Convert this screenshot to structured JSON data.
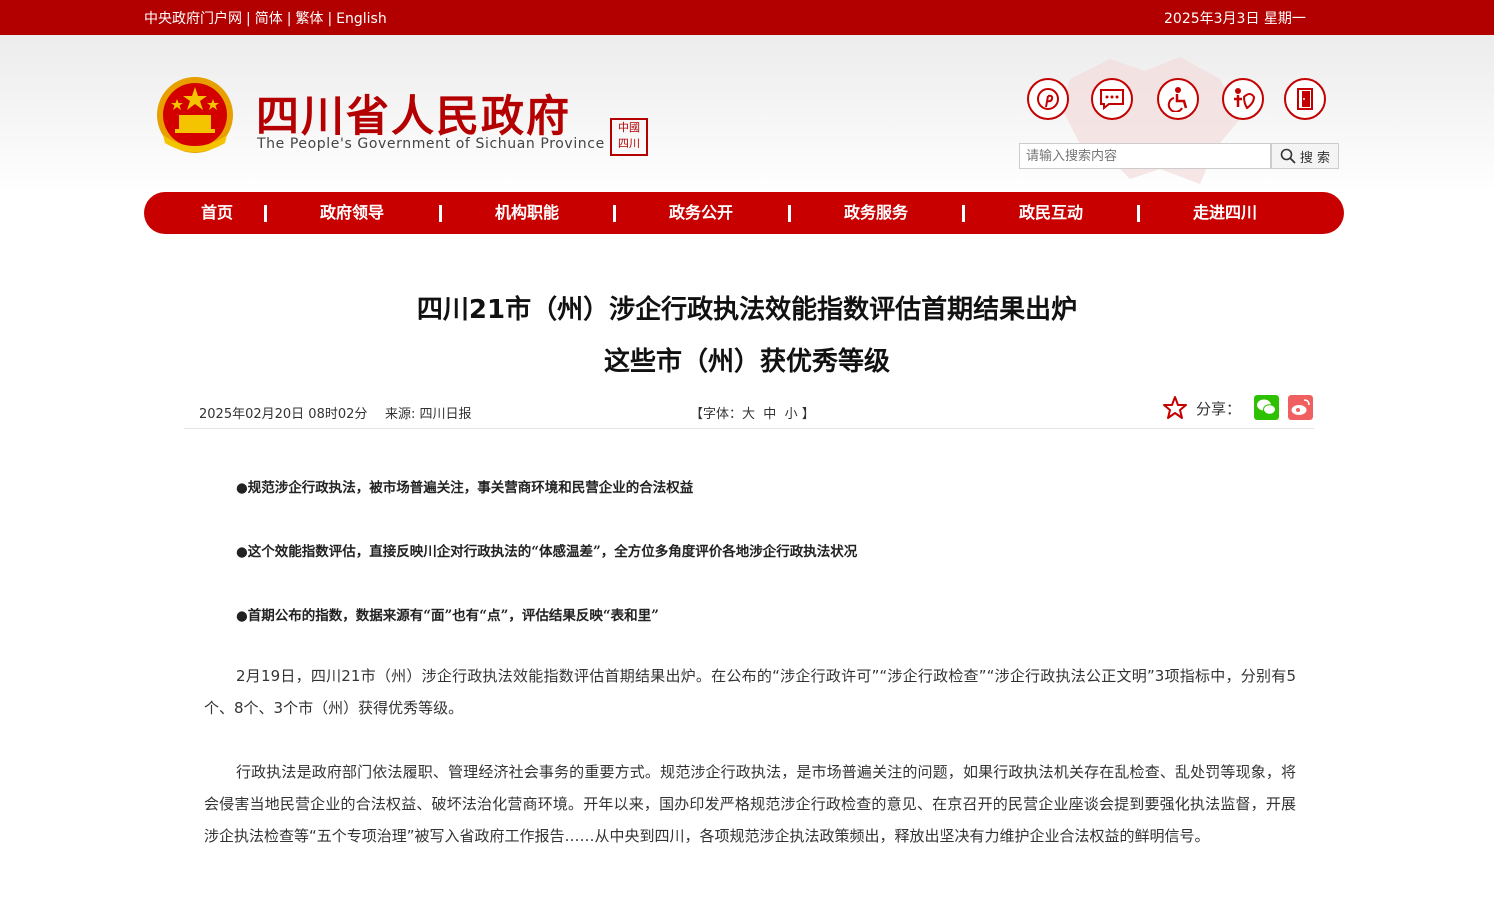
{
  "topbar": {
    "links": [
      "中央政府门户网",
      "简体",
      "繁体",
      "English"
    ],
    "date": "2025年3月3日 星期一"
  },
  "header": {
    "title_cn": "四川省人民政府",
    "title_en": "The People's Government of Sichuan Province",
    "seal_text": "中國四川",
    "icons": [
      "pinterest-like-icon",
      "message-icon",
      "accessibility-icon",
      "elder-care-icon",
      "exit-door-icon"
    ],
    "search": {
      "placeholder": "请输入搜索内容",
      "button_label": "搜 索"
    }
  },
  "nav": {
    "items": [
      "首页",
      "政府领导",
      "机构职能",
      "政务公开",
      "政务服务",
      "政民互动",
      "走进四川"
    ]
  },
  "article": {
    "title_line1": "四川21市（州）涉企行政执法效能指数评估首期结果出炉",
    "title_line2": "这些市（州）获优秀等级",
    "datetime": "2025年02月20日 08时02分",
    "source": "来源: 四川日报",
    "font_label_prefix": "【字体：",
    "font_sizes": [
      "大",
      "中",
      "小"
    ],
    "font_label_suffix": "】",
    "share_label": "分享：",
    "bullets": [
      "●规范涉企行政执法，被市场普遍关注，事关营商环境和民营企业的合法权益",
      "●这个效能指数评估，直接反映川企对行政执法的“体感温差”，全方位多角度评价各地涉企行政执法状况",
      "●首期公布的指数，数据来源有“面”也有“点”，评估结果反映“表和里”"
    ],
    "paragraphs": [
      "2月19日，四川21市（州）涉企行政执法效能指数评估首期结果出炉。在公布的“涉企行政许可”“涉企行政检查”“涉企行政执法公正文明”3项指标中，分别有5个、8个、3个市（州）获得优秀等级。",
      "行政执法是政府部门依法履职、管理经济社会事务的重要方式。规范涉企行政执法，是市场普遍关注的问题，如果行政执法机关存在乱检查、乱处罚等现象，将会侵害当地民营企业的合法权益、破坏法治化营商环境。开年以来，国办印发严格规范涉企行政检查的意见、在京召开的民营企业座谈会提到要强化执法监督，开展涉企执法检查等“五个专项治理”被写入省政府工作报告……从中央到四川，各项规范涉企执法政策频出，释放出坚决有力维护企业合法权益的鲜明信号。"
    ]
  },
  "colors": {
    "brand_red": "#b20000",
    "nav_red": "#c80000",
    "wechat_green": "#2dc100",
    "weibo_red": "#f06060"
  }
}
